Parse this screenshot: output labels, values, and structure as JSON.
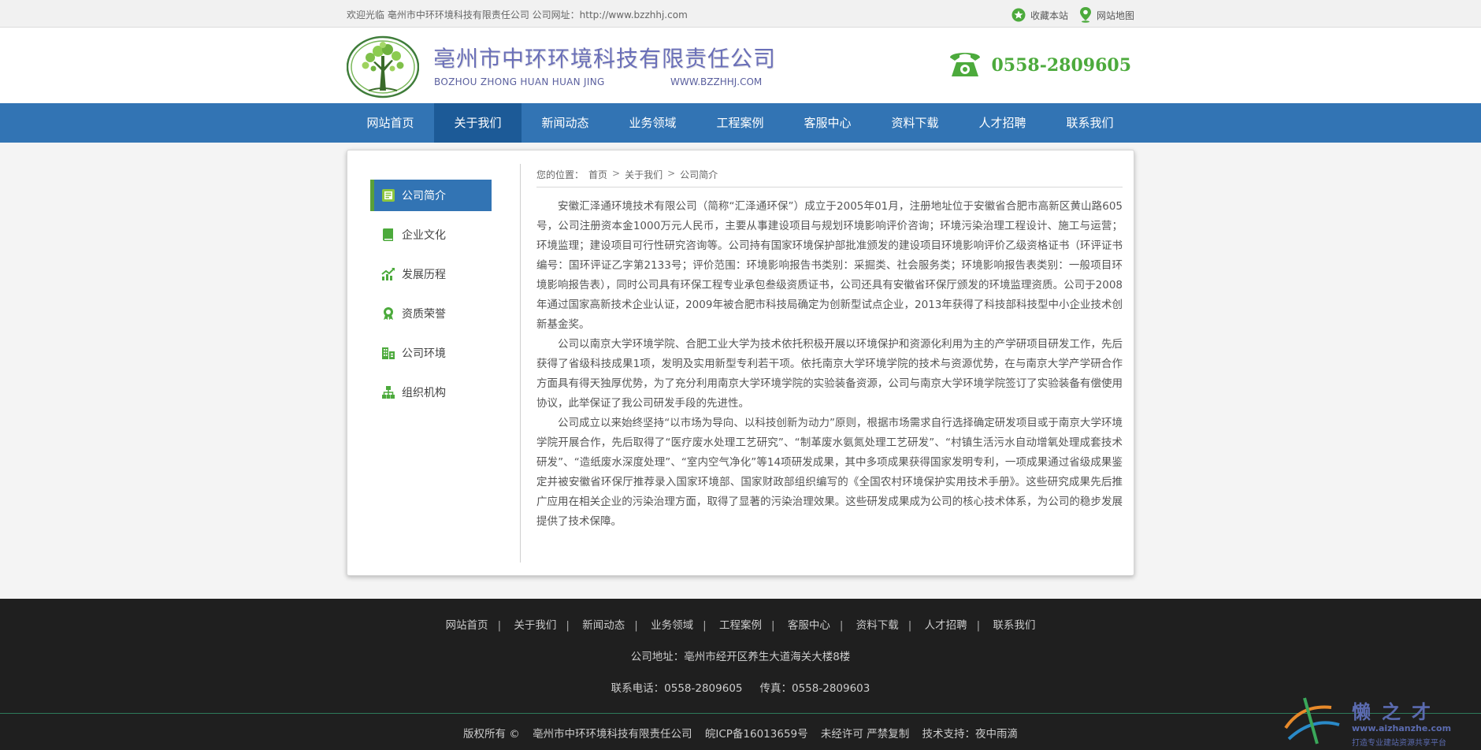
{
  "topbar": {
    "welcome": "欢迎光临 亳州市中环环境科技有限责任公司 公司网址：http://www.bzzhhj.com",
    "favorite": "收藏本站",
    "sitemap": "网站地图"
  },
  "header": {
    "title": "亳州市中环环境科技有限责任公司",
    "en": "BOZHOU ZHONG HUAN HUAN JING",
    "url": "WWW.BZZHHJ.COM",
    "phone": "0558-2809605"
  },
  "nav": [
    "网站首页",
    "关于我们",
    "新闻动态",
    "业务领域",
    "工程案例",
    "客服中心",
    "资料下载",
    "人才招聘",
    "联系我们"
  ],
  "nav_active": 1,
  "sidebar": [
    {
      "label": "公司简介",
      "icon": "document-icon",
      "active": true
    },
    {
      "label": "企业文化",
      "icon": "book-icon",
      "active": false
    },
    {
      "label": "发展历程",
      "icon": "growth-chart-icon",
      "active": false
    },
    {
      "label": "资质荣誉",
      "icon": "award-icon",
      "active": false
    },
    {
      "label": "公司环境",
      "icon": "building-icon",
      "active": false
    },
    {
      "label": "组织机构",
      "icon": "org-chart-icon",
      "active": false
    }
  ],
  "breadcrumb": {
    "prefix": "您的位置：",
    "home": "首页",
    "parent": "关于我们",
    "current": "公司简介",
    "sep": ">"
  },
  "article": [
    "安徽汇泽通环境技术有限公司（简称“汇泽通环保”）成立于2005年01月，注册地址位于安徽省合肥市高新区黄山路605号，公司注册资本金1000万元人民币，主要从事建设项目与规划环境影响评价咨询；环境污染治理工程设计、施工与运营；环境监理；建设项目可行性研究咨询等。公司持有国家环境保护部批准颁发的建设项目环境影响评价乙级资格证书（环评证书编号：国环评证乙字第2133号；评价范围：环境影响报告书类别：采掘类、社会服务类；环境影响报告表类别：一般项目环境影响报告表），同时公司具有环保工程专业承包叁级资质证书，公司还具有安徽省环保厅颁发的环境监理资质。公司于2008年通过国家高新技术企业认证，2009年被合肥市科技局确定为创新型试点企业，2013年获得了科技部科技型中小企业技术创新基金奖。",
    "公司以南京大学环境学院、合肥工业大学为技术依托积极开展以环境保护和资源化利用为主的产学研项目研发工作，先后获得了省级科技成果1项，发明及实用新型专利若干项。依托南京大学环境学院的技术与资源优势，在与南京大学产学研合作方面具有得天独厚优势，为了充分利用南京大学环境学院的实验装备资源，公司与南京大学环境学院签订了实验装备有偿使用协议，此举保证了我公司研发手段的先进性。",
    "公司成立以来始终坚持“以市场为导向、以科技创新为动力”原则，根据市场需求自行选择确定研发项目或于南京大学环境学院开展合作，先后取得了“医疗废水处理工艺研究”、“制革废水氨氮处理工艺研发”、“村镇生活污水自动增氧处理成套技术研发”、“造纸废水深度处理”、“室内空气净化”等14项研发成果，其中多项成果获得国家发明专利，一项成果通过省级成果鉴定并被安徽省环保厅推荐录入国家环境部、国家财政部组织编写的《全国农村环境保护实用技术手册》。这些研究成果先后推广应用在相关企业的污染治理方面，取得了显著的污染治理效果。这些研发成果成为公司的核心技术体系，为公司的稳步发展提供了技术保障。"
  ],
  "footer": {
    "nav": [
      "网站首页",
      "关于我们",
      "新闻动态",
      "业务领域",
      "工程案例",
      "客服中心",
      "资料下载",
      "人才招聘",
      "联系我们"
    ],
    "address": "公司地址：亳州市经开区养生大道海关大楼8楼",
    "tel": "联系电话：0558-2809605",
    "fax": "传真：0558-2809603",
    "copyright": "版权所有 ©",
    "company": "亳州市中环环境科技有限责任公司",
    "icp": "皖ICP备16013659号",
    "rights": "未经许可 严禁复制",
    "support": "技术支持：夜中雨滴"
  },
  "watermark": {
    "name": "懒之才",
    "url": "www.aizhanzhe.com",
    "slogan": "打造专业建站资源共享平台"
  },
  "colors": {
    "nav_bg": "#3274b4",
    "nav_active": "#1c5a97",
    "accent_green": "#4caa3c",
    "footer_bg": "#1f1f1f"
  }
}
